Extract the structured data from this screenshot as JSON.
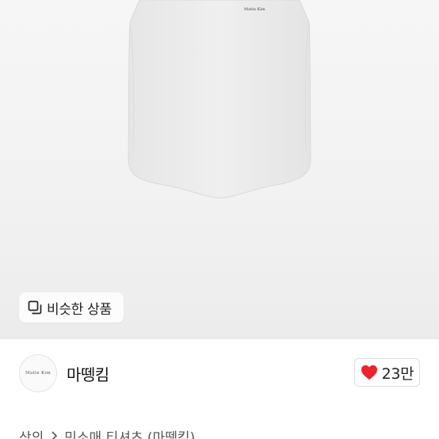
{
  "product_image": {
    "brand_print": "Matin  Kim",
    "colors": {
      "background": "#f3f3f3",
      "garment": "#ececec"
    }
  },
  "similar_button": {
    "label": "비슷한 상품",
    "icon": "similar-items-icon"
  },
  "seller": {
    "name": "마뗑킴",
    "avatar_logo": "Matin  Kim"
  },
  "like": {
    "count": "23만",
    "icon": "heart-icon",
    "color": "#e8242c"
  },
  "breadcrumb": {
    "items": [
      "상의",
      "민소매 티셔츠 (마뗑킴)"
    ],
    "separator_icon": "chevron-right-icon"
  }
}
